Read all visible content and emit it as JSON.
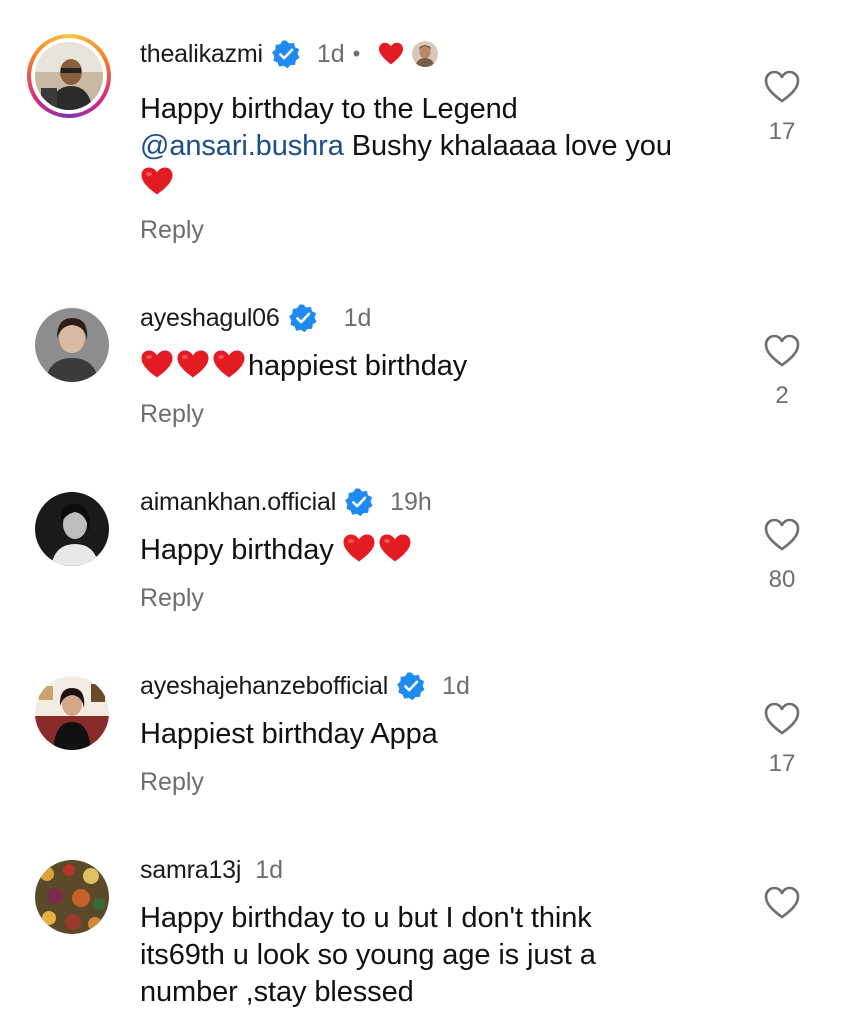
{
  "colors": {
    "verified": "#1f8bf0",
    "heart": "#e31b23",
    "mention": "#1d4d89",
    "muted": "#6e6e6e"
  },
  "comments": [
    {
      "username": "thealikazmi",
      "verified": true,
      "time": "1d",
      "author_liked": true,
      "text_parts": [
        "Happy birthday to the Legend",
        "@ansari.bushra",
        " Bushy khalaaaa love you"
      ],
      "emoji": [
        "red-heart"
      ],
      "reply_label": "Reply",
      "like_count": "17",
      "like_icon": "heart-outline-icon"
    },
    {
      "username": "ayeshagul06",
      "verified": true,
      "time": "1d",
      "emoji": [
        "red-heart",
        "red-heart",
        "red-heart"
      ],
      "text": "happiest birthday",
      "reply_label": "Reply",
      "like_count": "2",
      "like_icon": "heart-outline-icon"
    },
    {
      "username": "aimankhan.official",
      "verified": true,
      "time": "19h",
      "text": "Happy birthday ",
      "emoji": [
        "red-heart",
        "red-heart"
      ],
      "reply_label": "Reply",
      "like_count": "80",
      "like_icon": "heart-outline-icon"
    },
    {
      "username": "ayeshajehanzebofficial",
      "verified": true,
      "time": "1d",
      "text": "Happiest birthday Appa",
      "reply_label": "Reply",
      "like_count": "17",
      "like_icon": "heart-outline-icon"
    },
    {
      "username": "samra13j",
      "verified": false,
      "time": "1d",
      "text": "Happy birthday to u but I don't think its69th u look so young age is just a number ,stay blessed",
      "like_icon": "heart-outline-icon"
    }
  ]
}
